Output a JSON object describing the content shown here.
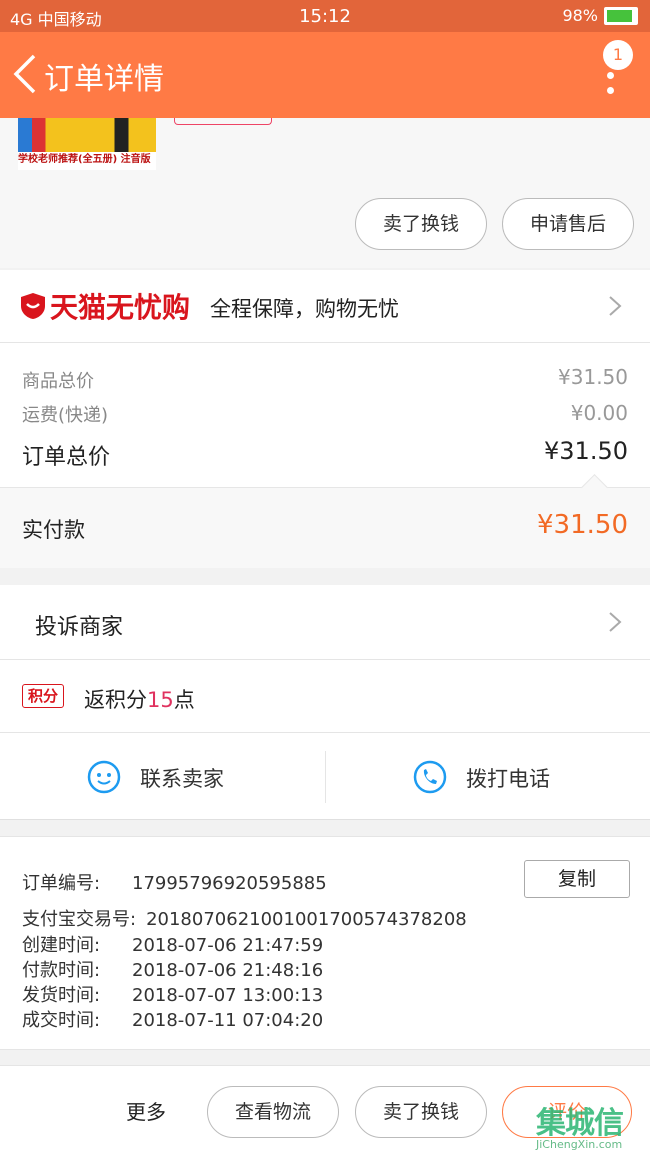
{
  "status_bar": {
    "carrier": "4G 中国移动",
    "time": "15:12",
    "battery": "98%",
    "battery_level": 0.98
  },
  "nav": {
    "title": "订单详情",
    "message_count": "1"
  },
  "product": {
    "book_caption": "学校老师推荐(全五册) 注音版",
    "exchange_label": "卖了换钱",
    "after_sale_label": "申请售后"
  },
  "tmall": {
    "brand": "天猫无忧购",
    "slogan": "全程保障，购物无忧"
  },
  "prices": {
    "goods_total_label": "商品总价",
    "goods_total_value": "¥31.50",
    "shipping_label": "运费(快递)",
    "shipping_value": "¥0.00",
    "order_total_label": "订单总价",
    "order_total_value": "¥31.50",
    "paid_label": "实付款",
    "paid_value": "¥31.50"
  },
  "complain": {
    "label": "投诉商家"
  },
  "points": {
    "badge": "积分",
    "prefix": "返积分",
    "amount": "15",
    "suffix": "点"
  },
  "contact": {
    "seller_label": "联系卖家",
    "phone_label": "拨打电话"
  },
  "order_info": {
    "copy_label": "复制",
    "lines": [
      {
        "key": "订单编号:",
        "value": "17995796920595885"
      },
      {
        "key": "支付宝交易号:",
        "value": "2018070621001001700574378208"
      },
      {
        "key": "创建时间:",
        "value": "2018-07-06 21:47:59"
      },
      {
        "key": "付款时间:",
        "value": "2018-07-06 21:48:16"
      },
      {
        "key": "发货时间:",
        "value": "2018-07-07 13:00:13"
      },
      {
        "key": "成交时间:",
        "value": "2018-07-11 07:04:20"
      }
    ]
  },
  "bottom_bar": {
    "more_label": "更多",
    "track_label": "查看物流",
    "exchange_label": "卖了换钱",
    "review_label": "评价"
  },
  "watermark": {
    "text": "集城信",
    "sub": "JiChengXin.com"
  },
  "colors": {
    "nav_bg": "#ff7a45",
    "status_bg": "#e2653a",
    "tmall_red": "#d9151d",
    "paid_orange": "#f26a25",
    "points_pink": "#e0325f"
  }
}
